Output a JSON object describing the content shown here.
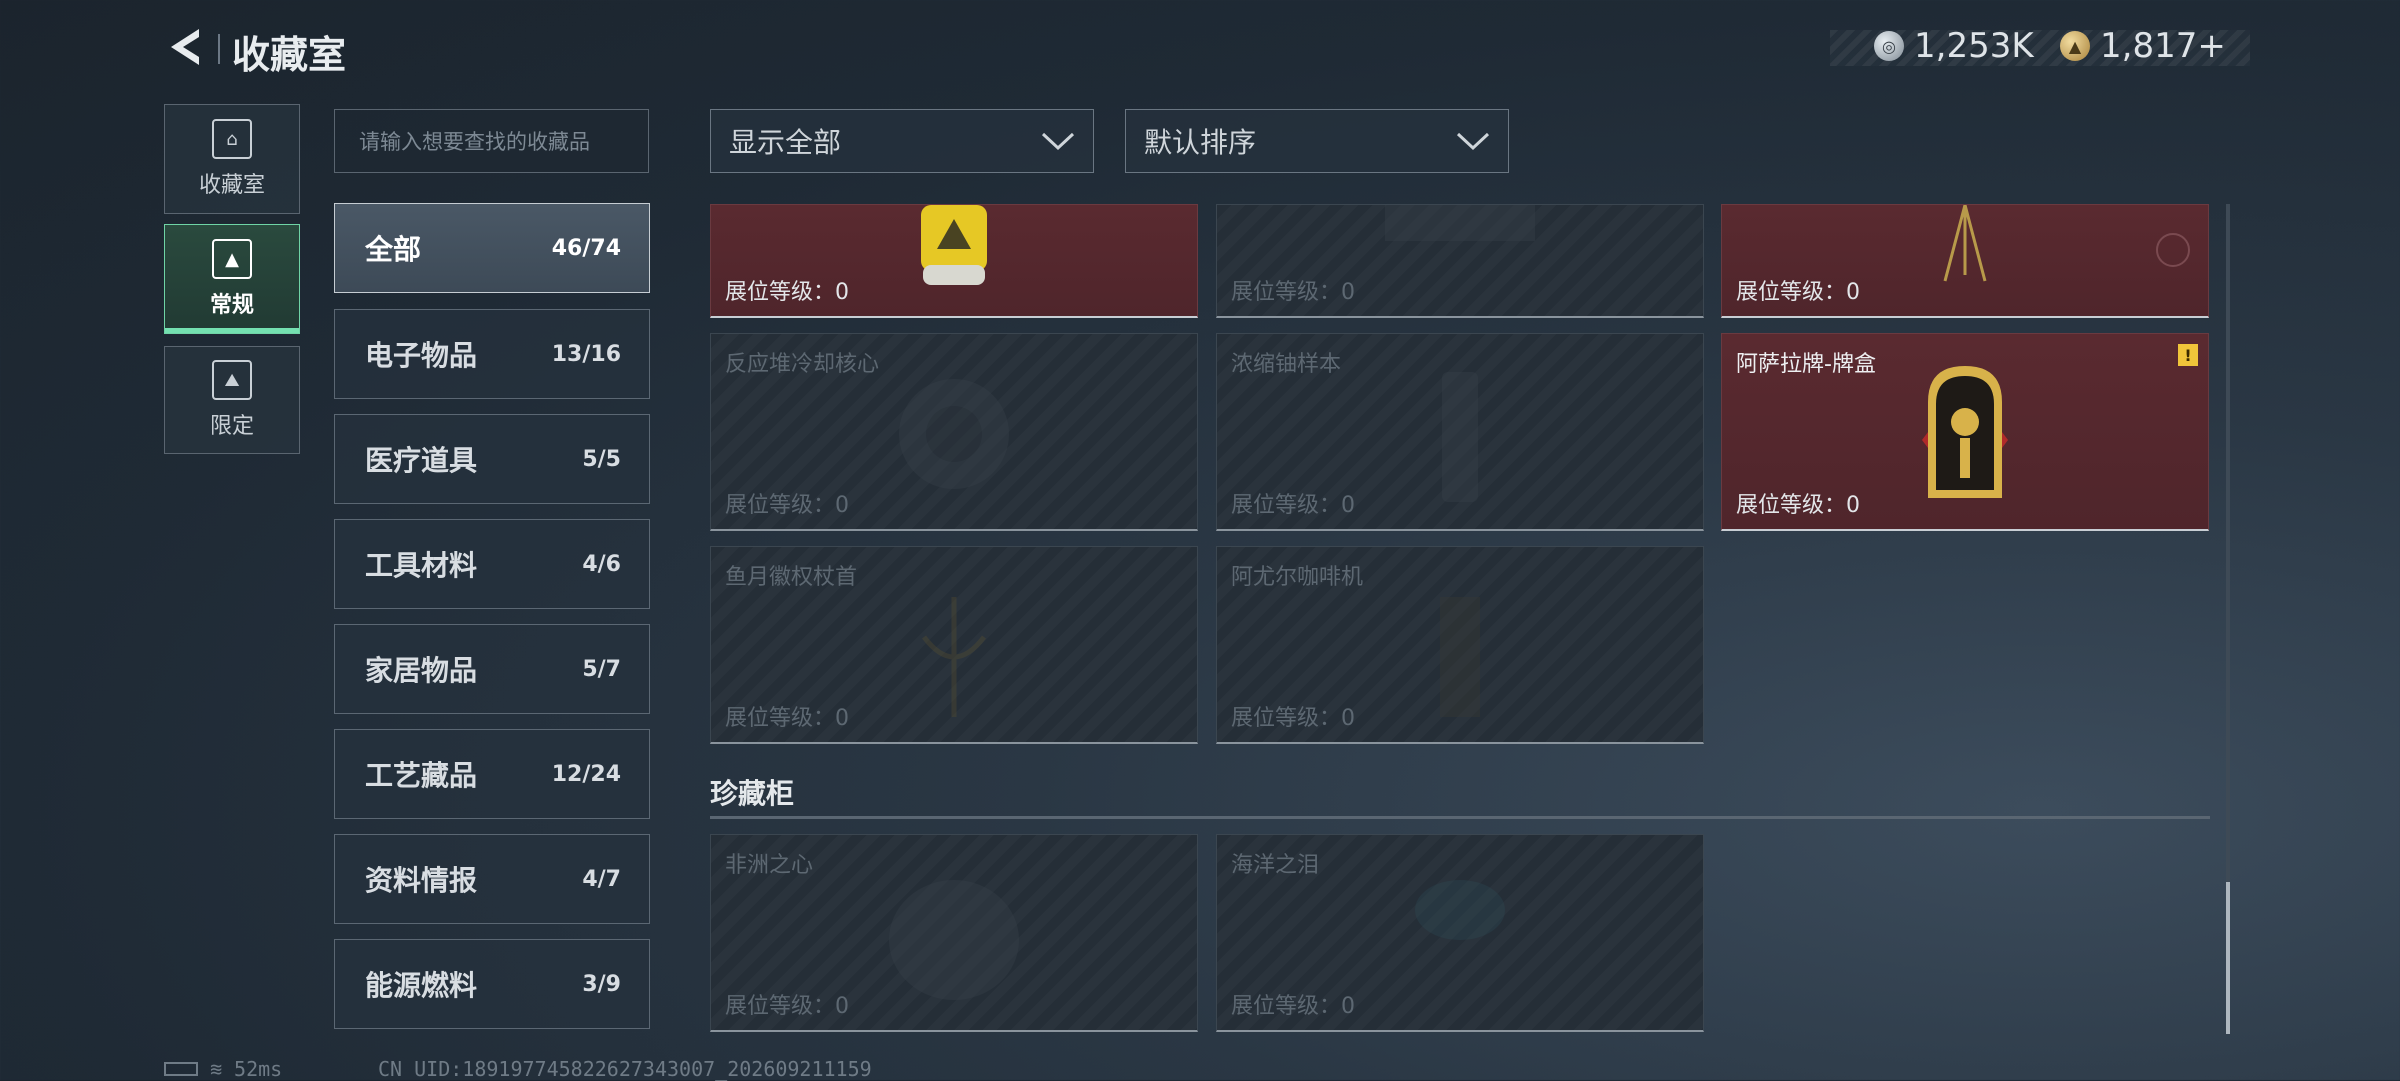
{
  "header": {
    "title": "收藏室",
    "currency_silver": "1,253K",
    "currency_gold": "1,817+"
  },
  "rail": [
    {
      "label": "收藏室",
      "icon": "vault-icon"
    },
    {
      "label": "常规",
      "icon": "regular-icon"
    },
    {
      "label": "限定",
      "icon": "limited-icon"
    }
  ],
  "search": {
    "placeholder": "请输入想要查找的收藏品"
  },
  "categories": [
    {
      "name": "全部",
      "count": "46/74"
    },
    {
      "name": "电子物品",
      "count": "13/16"
    },
    {
      "name": "医疗道具",
      "count": "5/5"
    },
    {
      "name": "工具材料",
      "count": "4/6"
    },
    {
      "name": "家居物品",
      "count": "5/7"
    },
    {
      "name": "工艺藏品",
      "count": "12/24"
    },
    {
      "name": "资料情报",
      "count": "4/7"
    },
    {
      "name": "能源燃料",
      "count": "3/9"
    }
  ],
  "filters": {
    "show": "显示全部",
    "sort": "默认排序"
  },
  "items": [
    {
      "name": "",
      "level": "展位等级：0"
    },
    {
      "name": "",
      "level": "展位等级：0"
    },
    {
      "name": "",
      "level": "展位等级：0"
    },
    {
      "name": "反应堆冷却核心",
      "level": "展位等级：0"
    },
    {
      "name": "浓缩铀样本",
      "level": "展位等级：0"
    },
    {
      "name": "阿萨拉牌-牌盒",
      "level": "展位等级：0"
    },
    {
      "name": "鱼月徽权杖首",
      "level": "展位等级：0"
    },
    {
      "name": "阿尤尔咖啡机",
      "level": "展位等级：0"
    }
  ],
  "section": {
    "title": "珍藏柜"
  },
  "treasures": [
    {
      "name": "非洲之心",
      "level": "展位等级：0"
    },
    {
      "name": "海洋之泪",
      "level": "展位等级：0"
    }
  ],
  "status": {
    "ping": "52ms",
    "uid": "CN UID:1891977458226273430​07_202609211159"
  },
  "colors": {
    "accent": "#74e0b0",
    "owned_card": "#5a2a30",
    "warning": "#f0c53a"
  }
}
